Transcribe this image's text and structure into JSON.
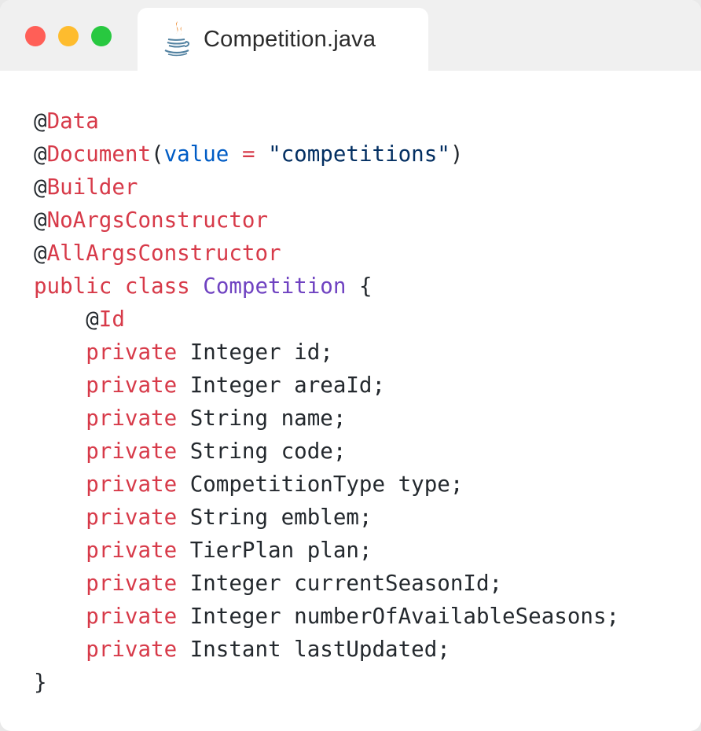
{
  "window": {
    "tab_title": "Competition.java",
    "tab_icon": "java-coffee-cup-icon",
    "controls": [
      "close-dot",
      "minimize-dot",
      "maximize-dot"
    ],
    "colors": {
      "close": "#ff5f57",
      "minimize": "#febc2e",
      "maximize": "#28c840",
      "keyword": "#d73a49",
      "class_name": "#6f42c1",
      "attribute": "#005cc5",
      "string": "#032f62"
    }
  },
  "code": {
    "lines": [
      [
        {
          "t": "at",
          "v": "@"
        },
        {
          "t": "anno",
          "v": "Data"
        }
      ],
      [
        {
          "t": "at",
          "v": "@"
        },
        {
          "t": "anno",
          "v": "Document"
        },
        {
          "t": "plain",
          "v": "("
        },
        {
          "t": "attr",
          "v": "value"
        },
        {
          "t": "plain",
          "v": " "
        },
        {
          "t": "op",
          "v": "="
        },
        {
          "t": "plain",
          "v": " "
        },
        {
          "t": "str",
          "v": "\"competitions\""
        },
        {
          "t": "plain",
          "v": ")"
        }
      ],
      [
        {
          "t": "at",
          "v": "@"
        },
        {
          "t": "anno",
          "v": "Builder"
        }
      ],
      [
        {
          "t": "at",
          "v": "@"
        },
        {
          "t": "anno",
          "v": "NoArgsConstructor"
        }
      ],
      [
        {
          "t": "at",
          "v": "@"
        },
        {
          "t": "anno",
          "v": "AllArgsConstructor"
        }
      ],
      [
        {
          "t": "kw",
          "v": "public"
        },
        {
          "t": "plain",
          "v": " "
        },
        {
          "t": "kw",
          "v": "class"
        },
        {
          "t": "plain",
          "v": " "
        },
        {
          "t": "class",
          "v": "Competition"
        },
        {
          "t": "plain",
          "v": " {"
        }
      ],
      [
        {
          "t": "plain",
          "v": "    "
        },
        {
          "t": "at",
          "v": "@"
        },
        {
          "t": "anno",
          "v": "Id"
        }
      ],
      [
        {
          "t": "plain",
          "v": "    "
        },
        {
          "t": "kw",
          "v": "private"
        },
        {
          "t": "plain",
          "v": " Integer id;"
        }
      ],
      [
        {
          "t": "plain",
          "v": "    "
        },
        {
          "t": "kw",
          "v": "private"
        },
        {
          "t": "plain",
          "v": " Integer areaId;"
        }
      ],
      [
        {
          "t": "plain",
          "v": "    "
        },
        {
          "t": "kw",
          "v": "private"
        },
        {
          "t": "plain",
          "v": " String name;"
        }
      ],
      [
        {
          "t": "plain",
          "v": "    "
        },
        {
          "t": "kw",
          "v": "private"
        },
        {
          "t": "plain",
          "v": " String code;"
        }
      ],
      [
        {
          "t": "plain",
          "v": "    "
        },
        {
          "t": "kw",
          "v": "private"
        },
        {
          "t": "plain",
          "v": " CompetitionType type;"
        }
      ],
      [
        {
          "t": "plain",
          "v": "    "
        },
        {
          "t": "kw",
          "v": "private"
        },
        {
          "t": "plain",
          "v": " String emblem;"
        }
      ],
      [
        {
          "t": "plain",
          "v": "    "
        },
        {
          "t": "kw",
          "v": "private"
        },
        {
          "t": "plain",
          "v": " TierPlan plan;"
        }
      ],
      [
        {
          "t": "plain",
          "v": "    "
        },
        {
          "t": "kw",
          "v": "private"
        },
        {
          "t": "plain",
          "v": " Integer currentSeasonId;"
        }
      ],
      [
        {
          "t": "plain",
          "v": "    "
        },
        {
          "t": "kw",
          "v": "private"
        },
        {
          "t": "plain",
          "v": " Integer numberOfAvailableSeasons;"
        }
      ],
      [
        {
          "t": "plain",
          "v": "    "
        },
        {
          "t": "kw",
          "v": "private"
        },
        {
          "t": "plain",
          "v": " Instant lastUpdated;"
        }
      ],
      [
        {
          "t": "plain",
          "v": "}"
        }
      ]
    ]
  }
}
